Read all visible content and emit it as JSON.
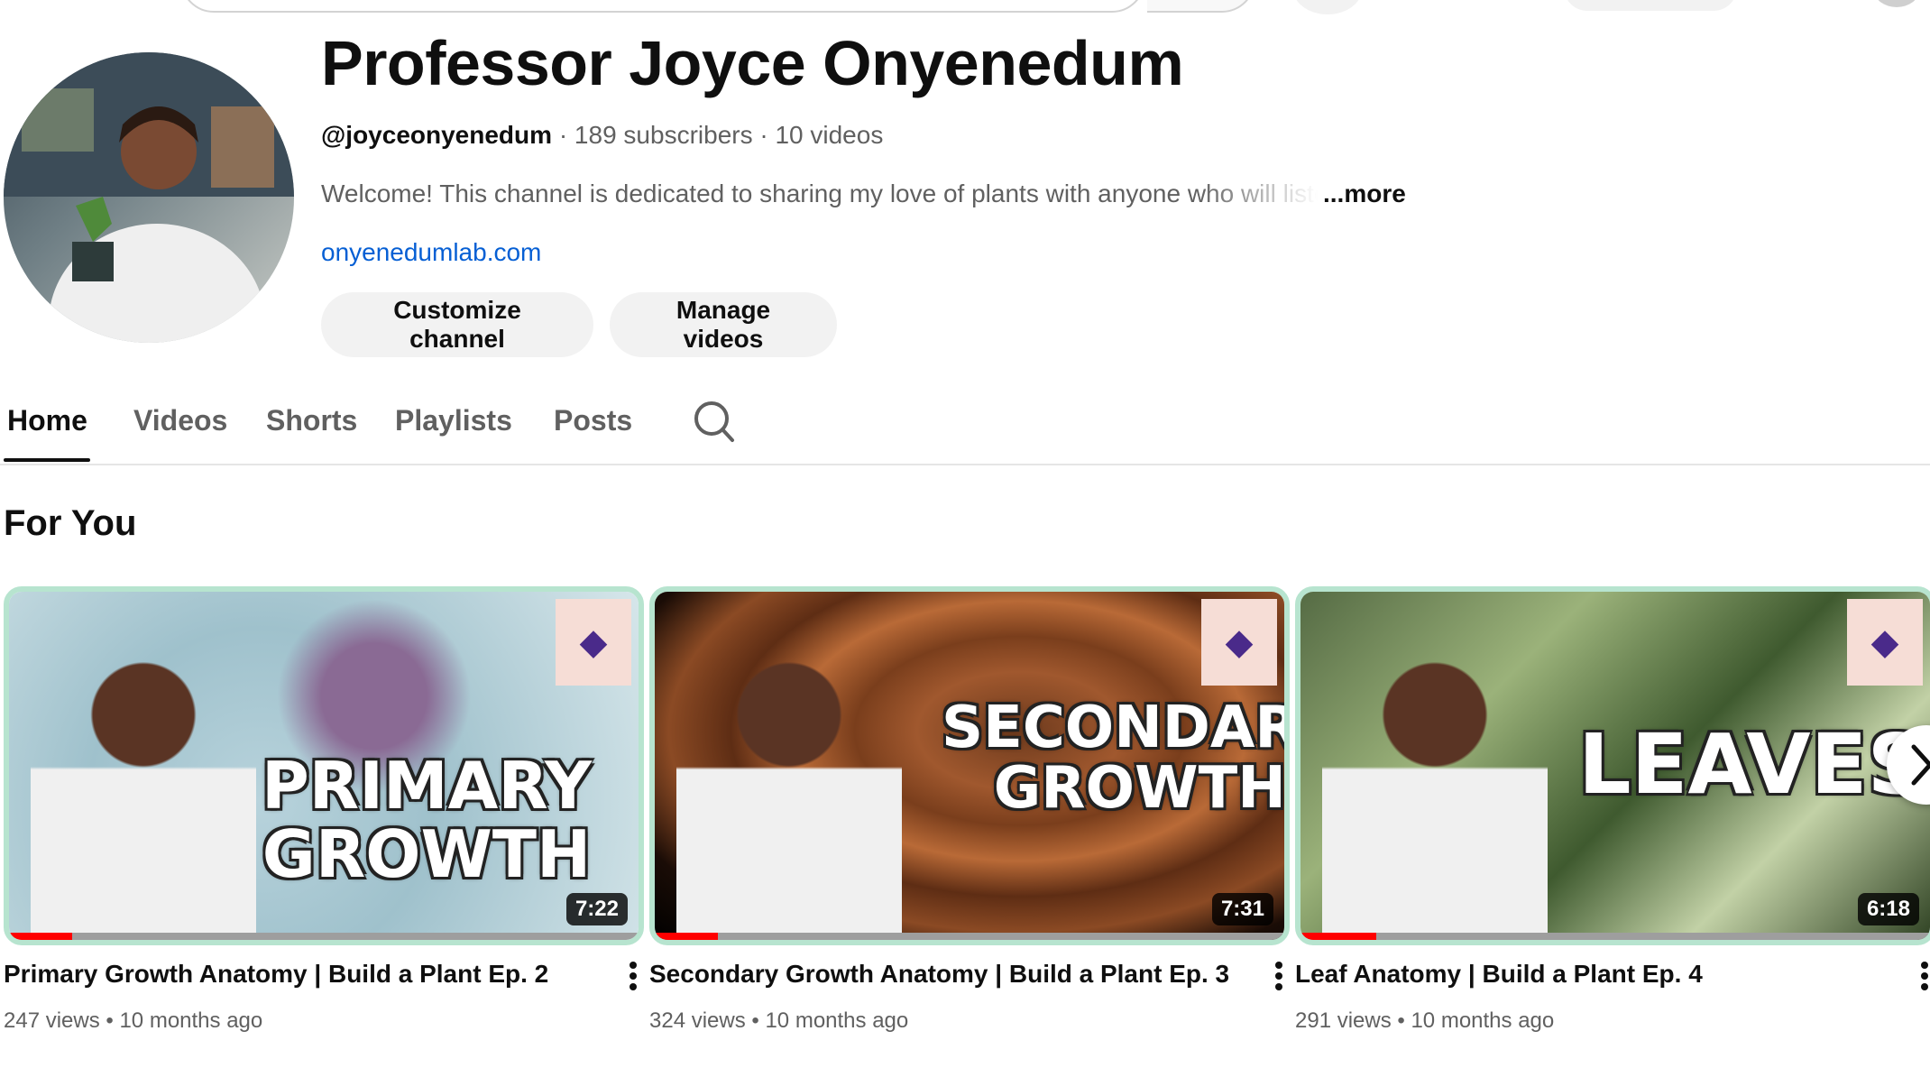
{
  "channel": {
    "name": "Professor Joyce Onyenedum",
    "handle": "@joyceonyenedum",
    "stats": " · 189 subscribers · 10 videos",
    "description": "Welcome! This channel is dedicated to sharing my love of plants with anyone who will listen",
    "more_label": "...more",
    "link": "onyenedumlab.com",
    "customize_label": "Customize channel",
    "manage_label": "Manage videos"
  },
  "tabs": [
    {
      "label": "Home",
      "active": true
    },
    {
      "label": "Videos"
    },
    {
      "label": "Shorts"
    },
    {
      "label": "Playlists"
    },
    {
      "label": "Posts"
    }
  ],
  "section": {
    "title": "For You"
  },
  "videos": [
    {
      "title": "Primary Growth Anatomy | Build a Plant Ep. 2",
      "thumb_line1": "PRIMARY",
      "thumb_line2": "GROWTH",
      "duration": "7:22",
      "meta": "247 views • 10 months ago",
      "progress": 0.1
    },
    {
      "title": "Secondary Growth Anatomy | Build a Plant Ep. 3",
      "thumb_line1": "SECONDARY",
      "thumb_line2": "GROWTH",
      "duration": "7:31",
      "meta": "324 views • 10 months ago",
      "progress": 0.1
    },
    {
      "title": "Leaf Anatomy | Build a Plant Ep. 4",
      "thumb_line1": "LEAVES",
      "thumb_line2": "",
      "duration": "6:18",
      "meta": "291 views • 10 months ago",
      "progress": 0.12
    }
  ],
  "colors": {
    "link": "#065fd4",
    "progress": "#ff0000",
    "thumb_border": "#b7e4cf"
  },
  "icons": [
    "search-icon",
    "more-vert-icon",
    "chevron-right-icon"
  ]
}
